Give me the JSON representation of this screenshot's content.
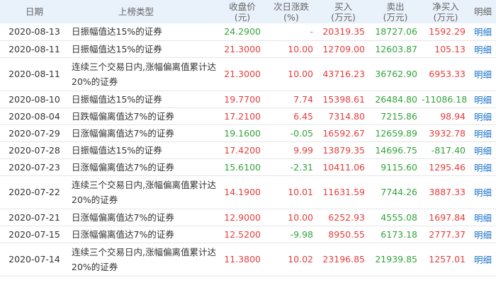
{
  "headers": {
    "date": "日期",
    "type": "上榜类型",
    "close": [
      "收盘价",
      "(元)"
    ],
    "change": [
      "次日涨跌",
      "(%)"
    ],
    "buy": [
      "买入",
      "(万元)"
    ],
    "sell": [
      "卖出",
      "(万元)"
    ],
    "net": [
      "净买入",
      "(万元)"
    ],
    "detail": "明细"
  },
  "colors": {
    "red": "#e43d3d",
    "green": "#33a33c",
    "link": "#1a73c8",
    "header_bg": "#e9f1fb"
  },
  "rows": [
    {
      "date": "2020-08-13",
      "type": "日振幅值达15%的证券",
      "close": "24.2900",
      "close_color": "green",
      "change": "-",
      "change_color": "gray",
      "buy": "20319.35",
      "sell": "18727.06",
      "net": "1592.29",
      "net_color": "red",
      "detail": "明细"
    },
    {
      "date": "2020-08-11",
      "type": "日振幅值达15%的证券",
      "close": "21.3000",
      "close_color": "red",
      "change": "10.00",
      "change_color": "red",
      "buy": "12709.00",
      "sell": "12603.87",
      "net": "105.13",
      "net_color": "red",
      "detail": "明细"
    },
    {
      "date": "2020-08-11",
      "type": "连续三个交易日内,涨幅偏离值累计达20%的证券",
      "close": "21.3000",
      "close_color": "red",
      "change": "10.00",
      "change_color": "red",
      "buy": "43716.23",
      "sell": "36762.90",
      "net": "6953.33",
      "net_color": "red",
      "detail": "明细"
    },
    {
      "date": "2020-08-10",
      "type": "日振幅值达15%的证券",
      "close": "19.7700",
      "close_color": "red",
      "change": "7.74",
      "change_color": "red",
      "buy": "15398.61",
      "sell": "26484.80",
      "net": "-11086.18",
      "net_color": "green",
      "detail": "明细"
    },
    {
      "date": "2020-08-04",
      "type": "日跌幅偏离值达7%的证券",
      "close": "17.2100",
      "close_color": "red",
      "change": "6.45",
      "change_color": "red",
      "buy": "7314.80",
      "sell": "7215.86",
      "net": "98.94",
      "net_color": "red",
      "detail": "明细"
    },
    {
      "date": "2020-07-29",
      "type": "日涨幅偏离值达7%的证券",
      "close": "19.1600",
      "close_color": "green",
      "change": "-0.05",
      "change_color": "green",
      "buy": "16592.67",
      "sell": "12659.89",
      "net": "3932.78",
      "net_color": "red",
      "detail": "明细"
    },
    {
      "date": "2020-07-28",
      "type": "日振幅值达15%的证券",
      "close": "17.4200",
      "close_color": "red",
      "change": "9.99",
      "change_color": "red",
      "buy": "13879.35",
      "sell": "14696.75",
      "net": "-817.40",
      "net_color": "green",
      "detail": "明细"
    },
    {
      "date": "2020-07-23",
      "type": "日涨幅偏离值达7%的证券",
      "close": "15.6100",
      "close_color": "green",
      "change": "-2.31",
      "change_color": "green",
      "buy": "10411.06",
      "sell": "9115.60",
      "net": "1295.46",
      "net_color": "red",
      "detail": "明细"
    },
    {
      "date": "2020-07-22",
      "type": "连续三个交易日内,涨幅偏离值累计达20%的证券",
      "close": "14.1900",
      "close_color": "red",
      "change": "10.01",
      "change_color": "red",
      "buy": "11631.59",
      "sell": "7744.26",
      "net": "3887.33",
      "net_color": "red",
      "detail": "明细"
    },
    {
      "date": "2020-07-21",
      "type": "日涨幅偏离值达7%的证券",
      "close": "12.9000",
      "close_color": "red",
      "change": "10.00",
      "change_color": "red",
      "buy": "6252.93",
      "sell": "4555.08",
      "net": "1697.84",
      "net_color": "red",
      "detail": "明细"
    },
    {
      "date": "2020-07-15",
      "type": "日涨幅偏离值达7%的证券",
      "close": "12.5200",
      "close_color": "red",
      "change": "-9.98",
      "change_color": "green",
      "buy": "8950.55",
      "sell": "6173.18",
      "net": "2777.37",
      "net_color": "red",
      "detail": "明细"
    },
    {
      "date": "2020-07-14",
      "type": "连续三个交易日内,涨幅偏离值累计达20%的证券",
      "close": "11.3800",
      "close_color": "red",
      "change": "10.02",
      "change_color": "red",
      "buy": "23196.85",
      "sell": "21939.85",
      "net": "1257.01",
      "net_color": "red",
      "detail": "明细"
    }
  ]
}
